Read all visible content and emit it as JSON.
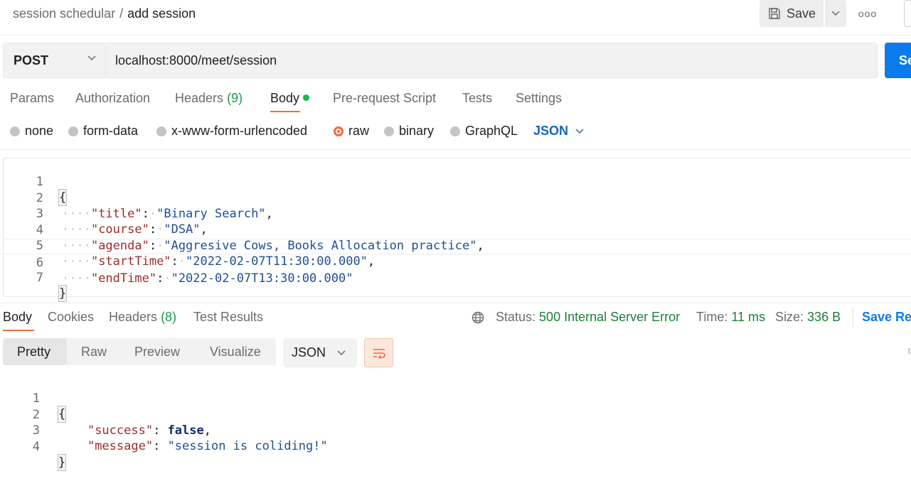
{
  "header": {
    "breadcrumb_parent": "session schedular",
    "breadcrumb_sep": "/",
    "breadcrumb_current": "add session",
    "save_label": "Save",
    "more_label": "ooo"
  },
  "request": {
    "method": "POST",
    "url": "localhost:8000/meet/session",
    "send_label": "Se",
    "tabs": [
      {
        "label": "Params"
      },
      {
        "label": "Authorization"
      },
      {
        "label": "Headers",
        "count": "(9)"
      },
      {
        "label": "Body"
      },
      {
        "label": "Pre-request Script"
      },
      {
        "label": "Tests"
      },
      {
        "label": "Settings"
      }
    ],
    "body_types": [
      "none",
      "form-data",
      "x-www-form-urlencoded",
      "raw",
      "binary",
      "GraphQL"
    ],
    "selected_body_type": "raw",
    "language": "JSON",
    "line_numbers": [
      "1",
      "2",
      "3",
      "4",
      "5",
      "6",
      "7"
    ],
    "body_lines": {
      "open": "{",
      "l2_key": "\"title\"",
      "l2_val": "\"Binary Search\"",
      "l3_key": "\"course\"",
      "l3_val": "\"DSA\"",
      "l4_key": "\"agenda\"",
      "l4_val": "\"Aggresive Cows, Books Allocation practice\"",
      "l5_key": "\"startTime\"",
      "l5_val": "\"2022-02-07T11:30:00.000\"",
      "l6_key": "\"endTime\"",
      "l6_val": "\"2022-02-07T13:30:00.000\"",
      "close": "}"
    }
  },
  "response": {
    "tabs": [
      {
        "label": "Body"
      },
      {
        "label": "Cookies"
      },
      {
        "label": "Headers",
        "count": "(8)"
      },
      {
        "label": "Test Results"
      }
    ],
    "status_label": "Status:",
    "status_value": "500 Internal Server Error",
    "time_label": "Time:",
    "time_value": "11 ms",
    "size_label": "Size:",
    "size_value": "336 B",
    "save_label": "Save Re",
    "views": [
      "Pretty",
      "Raw",
      "Preview",
      "Visualize"
    ],
    "format": "JSON",
    "line_numbers": [
      "1",
      "2",
      "3",
      "4"
    ],
    "body_lines": {
      "open": "{",
      "l2_key": "\"success\"",
      "l2_val": "false",
      "l3_key": "\"message\"",
      "l3_val": "\"session is coliding!\"",
      "close": "}"
    }
  },
  "colors": {
    "accent": "#f26b3a",
    "send": "#097bed",
    "success_green": "#1a7f37",
    "dot_green": "#0cbb52"
  }
}
